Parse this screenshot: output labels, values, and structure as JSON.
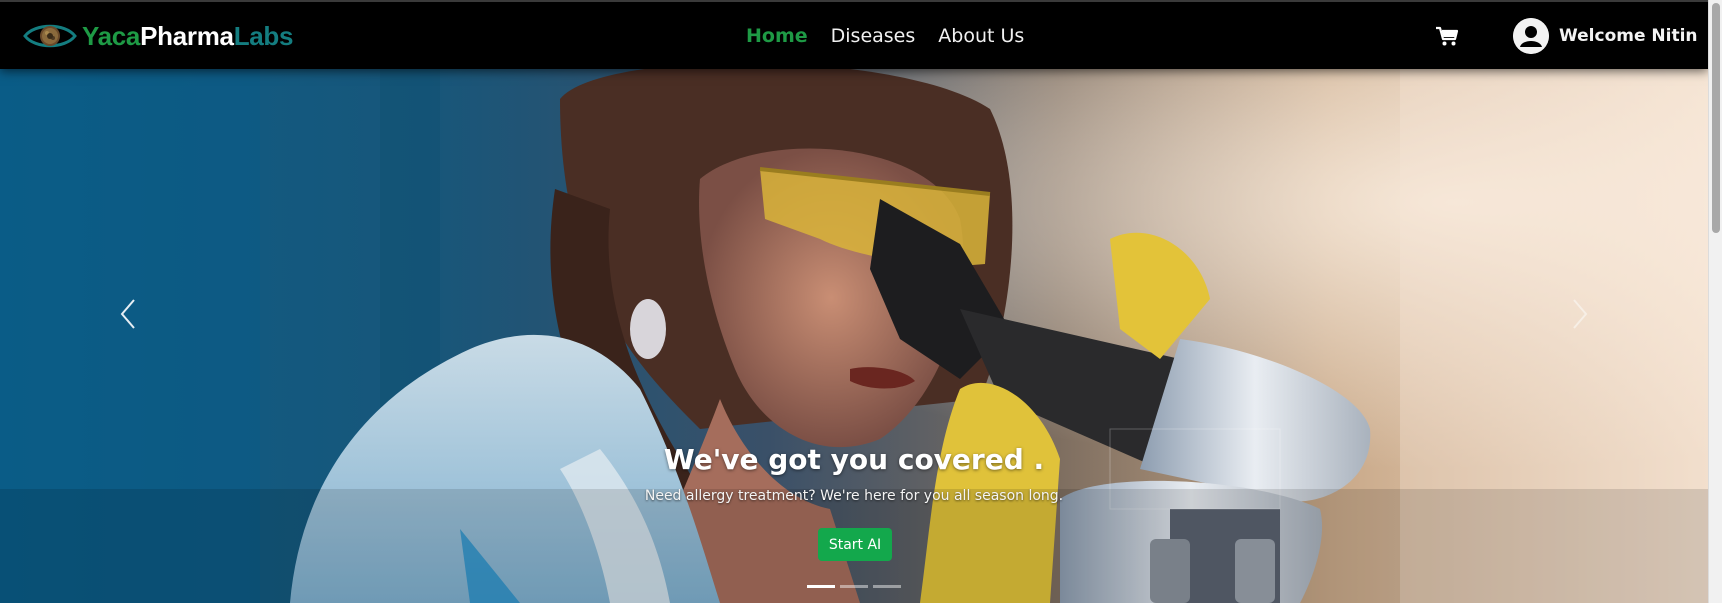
{
  "brand": {
    "parts": [
      {
        "text": "Yaca",
        "color": "#1e9a45"
      },
      {
        "text": "Pharma",
        "color": "#ffffff"
      },
      {
        "text": "Labs",
        "color": "#147d80"
      }
    ],
    "logo_icon": "eye-logo-icon"
  },
  "nav": {
    "links": [
      {
        "label": "Home",
        "active": true
      },
      {
        "label": "Diseases",
        "active": false
      },
      {
        "label": "About Us",
        "active": false
      }
    ],
    "active_color": "#1e9a45"
  },
  "header_right": {
    "cart_icon": "shopping-cart-icon",
    "avatar_icon": "user-avatar-icon",
    "welcome_text": "Welcome Nitin"
  },
  "hero": {
    "image": "scientist-looking-through-microscope",
    "title": "We've got you covered .",
    "subtitle": "Need allergy treatment? We're here for you all season long.",
    "cta_label": "Start AI",
    "cta_color": "#13a84c",
    "prev_icon": "chevron-left-icon",
    "next_icon": "chevron-right-icon",
    "slides_total": 3,
    "active_slide": 1
  }
}
